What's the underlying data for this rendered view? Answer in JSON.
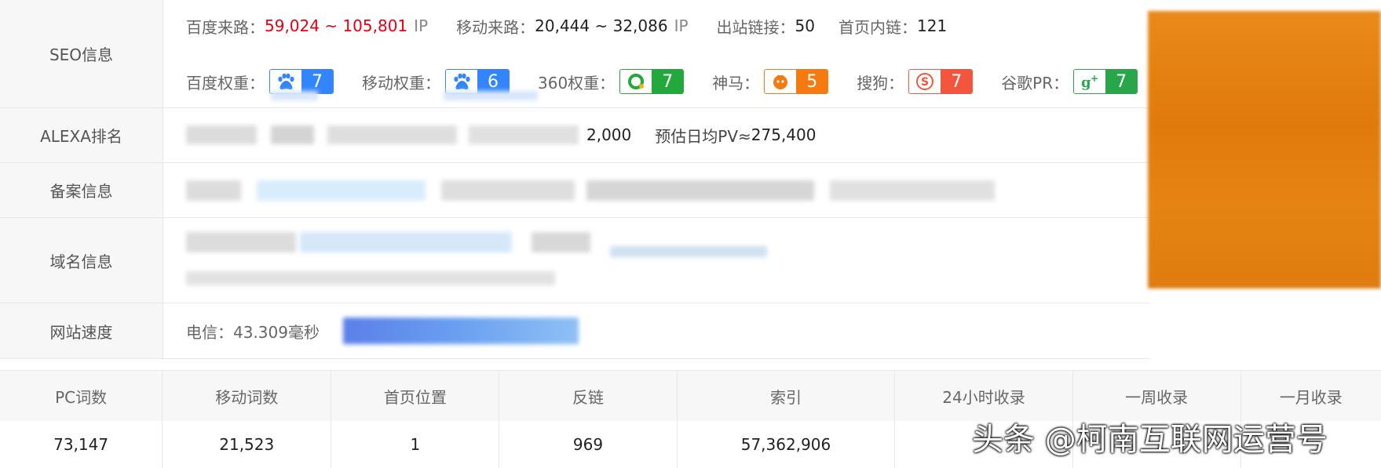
{
  "labels": {
    "seo": "SEO信息",
    "alexa": "ALEXA排名",
    "icp": "备案信息",
    "domain": "域名信息",
    "speed": "网站速度"
  },
  "seo": {
    "baidu_traffic_label": "百度来路：",
    "baidu_traffic_value": "59,024 ~ 105,801",
    "baidu_traffic_unit": "IP",
    "mobile_traffic_label": "移动来路：",
    "mobile_traffic_value": "20,444 ~ 32,086",
    "mobile_traffic_unit": "IP",
    "outlinks_label": "出站链接：",
    "outlinks_value": "50",
    "homepage_links_label": "首页内链：",
    "homepage_links_value": "121",
    "weights": [
      {
        "label": "百度权重：",
        "value": "7",
        "icon": "baidu-paw-icon"
      },
      {
        "label": "移动权重：",
        "value": "6",
        "icon": "baidu-paw-icon"
      },
      {
        "label": "360权重：",
        "value": "7",
        "icon": "360-icon"
      },
      {
        "label": "神马：",
        "value": "5",
        "icon": "shenma-icon"
      },
      {
        "label": "搜狗：",
        "value": "7",
        "icon": "sogou-icon"
      },
      {
        "label": "谷歌PR：",
        "value": "7",
        "icon": "google-plus-icon"
      }
    ]
  },
  "alexa": {
    "partial_value": "2,000",
    "pv_label": "预估日均PV≈",
    "pv_value": "275,400"
  },
  "speed": {
    "label": "电信：43.309毫秒"
  },
  "stats": {
    "headers": [
      "PC词数",
      "移动词数",
      "首页位置",
      "反链",
      "索引",
      "24小时收录",
      "一周收录",
      "一月收录"
    ],
    "values": [
      "73,147",
      "21,523",
      "1",
      "969",
      "57,362,906",
      "",
      "",
      ""
    ]
  },
  "watermark": "头条 @柯南互联网运营号",
  "colors": {
    "red": "#e60012",
    "baidu_blue": "#3385ff",
    "green_360": "#22a83c",
    "shenma_orange": "#f57b10",
    "sogou_red": "#f4563d",
    "google_green": "#2aa64a"
  }
}
